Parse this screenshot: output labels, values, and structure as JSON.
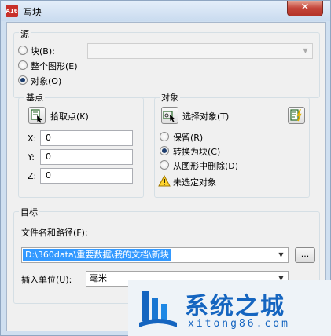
{
  "window": {
    "title": "写块",
    "app_icon_text": "A16",
    "close_glyph": "✕"
  },
  "source": {
    "heading": "源",
    "options": [
      {
        "label": "块",
        "key": "(B)",
        "suffix": ":",
        "checked": false
      },
      {
        "label": "整个图形",
        "key": "(E)",
        "checked": false
      },
      {
        "label": "对象",
        "key": "(O)",
        "checked": true
      }
    ],
    "block_combo_value": ""
  },
  "base_point": {
    "heading": "基点",
    "pick_label": "拾取点",
    "pick_key": "(K)",
    "fields": [
      {
        "label": "X:",
        "value": "0"
      },
      {
        "label": "Y:",
        "value": "0"
      },
      {
        "label": "Z:",
        "value": "0"
      }
    ]
  },
  "objects": {
    "heading": "对象",
    "select_label": "选择对象",
    "select_key": "(T)",
    "options": [
      {
        "label": "保留",
        "key": "(R)",
        "checked": false
      },
      {
        "label": "转换为块",
        "key": "(C)",
        "checked": true
      },
      {
        "label": "从图形中删除",
        "key": "(D)",
        "checked": false
      }
    ],
    "warning": "未选定对象"
  },
  "destination": {
    "heading": "目标",
    "path_label": "文件名和路径",
    "path_key": "(F)",
    "path_suffix": ":",
    "path_value": "D:\\360data\\重要数据\\我的文档\\新块",
    "browse_label": "...",
    "units_label": "插入单位",
    "units_key": "(U)",
    "units_suffix": ":",
    "units_value": "毫米"
  },
  "watermark": {
    "brand": "系统之城",
    "site": "xitong86.com"
  },
  "colors": {
    "accent": "#3399ff",
    "close": "#c4453a",
    "watermark_blue": "#1565c0"
  }
}
